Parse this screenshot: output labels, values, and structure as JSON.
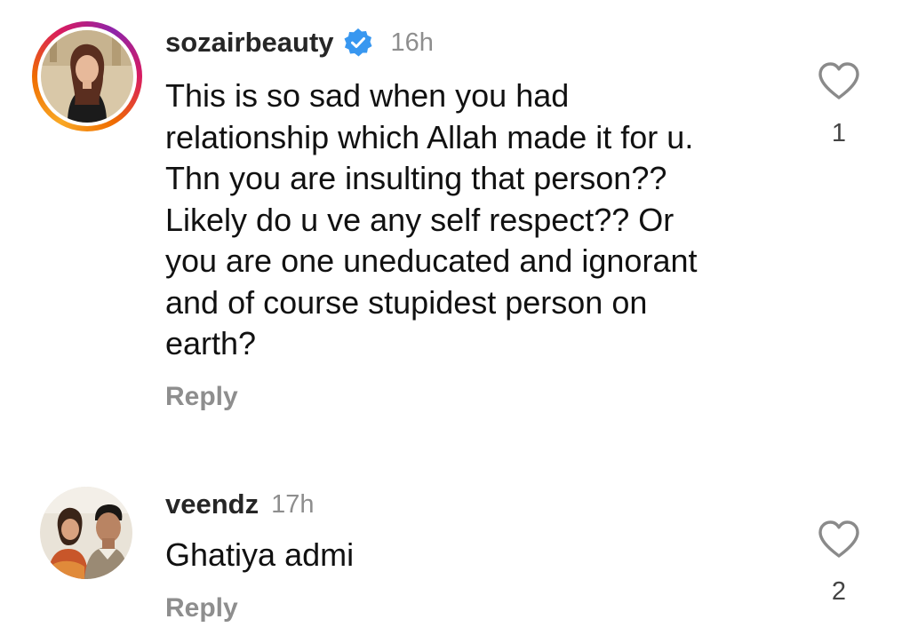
{
  "comments": [
    {
      "username": "sozairbeauty",
      "verified": true,
      "time": "16h",
      "lines": [
        "This is so sad when you had",
        "relationship which Allah made it for u.",
        "Thn you are insulting that person??",
        "Likely do u ve any self respect?? Or",
        "you are one uneducated and ignorant",
        "and of course stupidest person on",
        "earth?"
      ],
      "reply_label": "Reply",
      "like_count": "1",
      "like_icon": "heart-outline-icon"
    },
    {
      "username": "veendz",
      "verified": false,
      "time": "17h",
      "lines": [
        "Ghatiya admi"
      ],
      "reply_label": "Reply",
      "like_count": "2",
      "like_icon": "heart-outline-icon"
    }
  ],
  "colors": {
    "verified_badge": "#3897f0",
    "muted_text": "#8e8e8e",
    "story_ring": [
      "#f9a825",
      "#d81b60",
      "#8e24aa"
    ]
  }
}
